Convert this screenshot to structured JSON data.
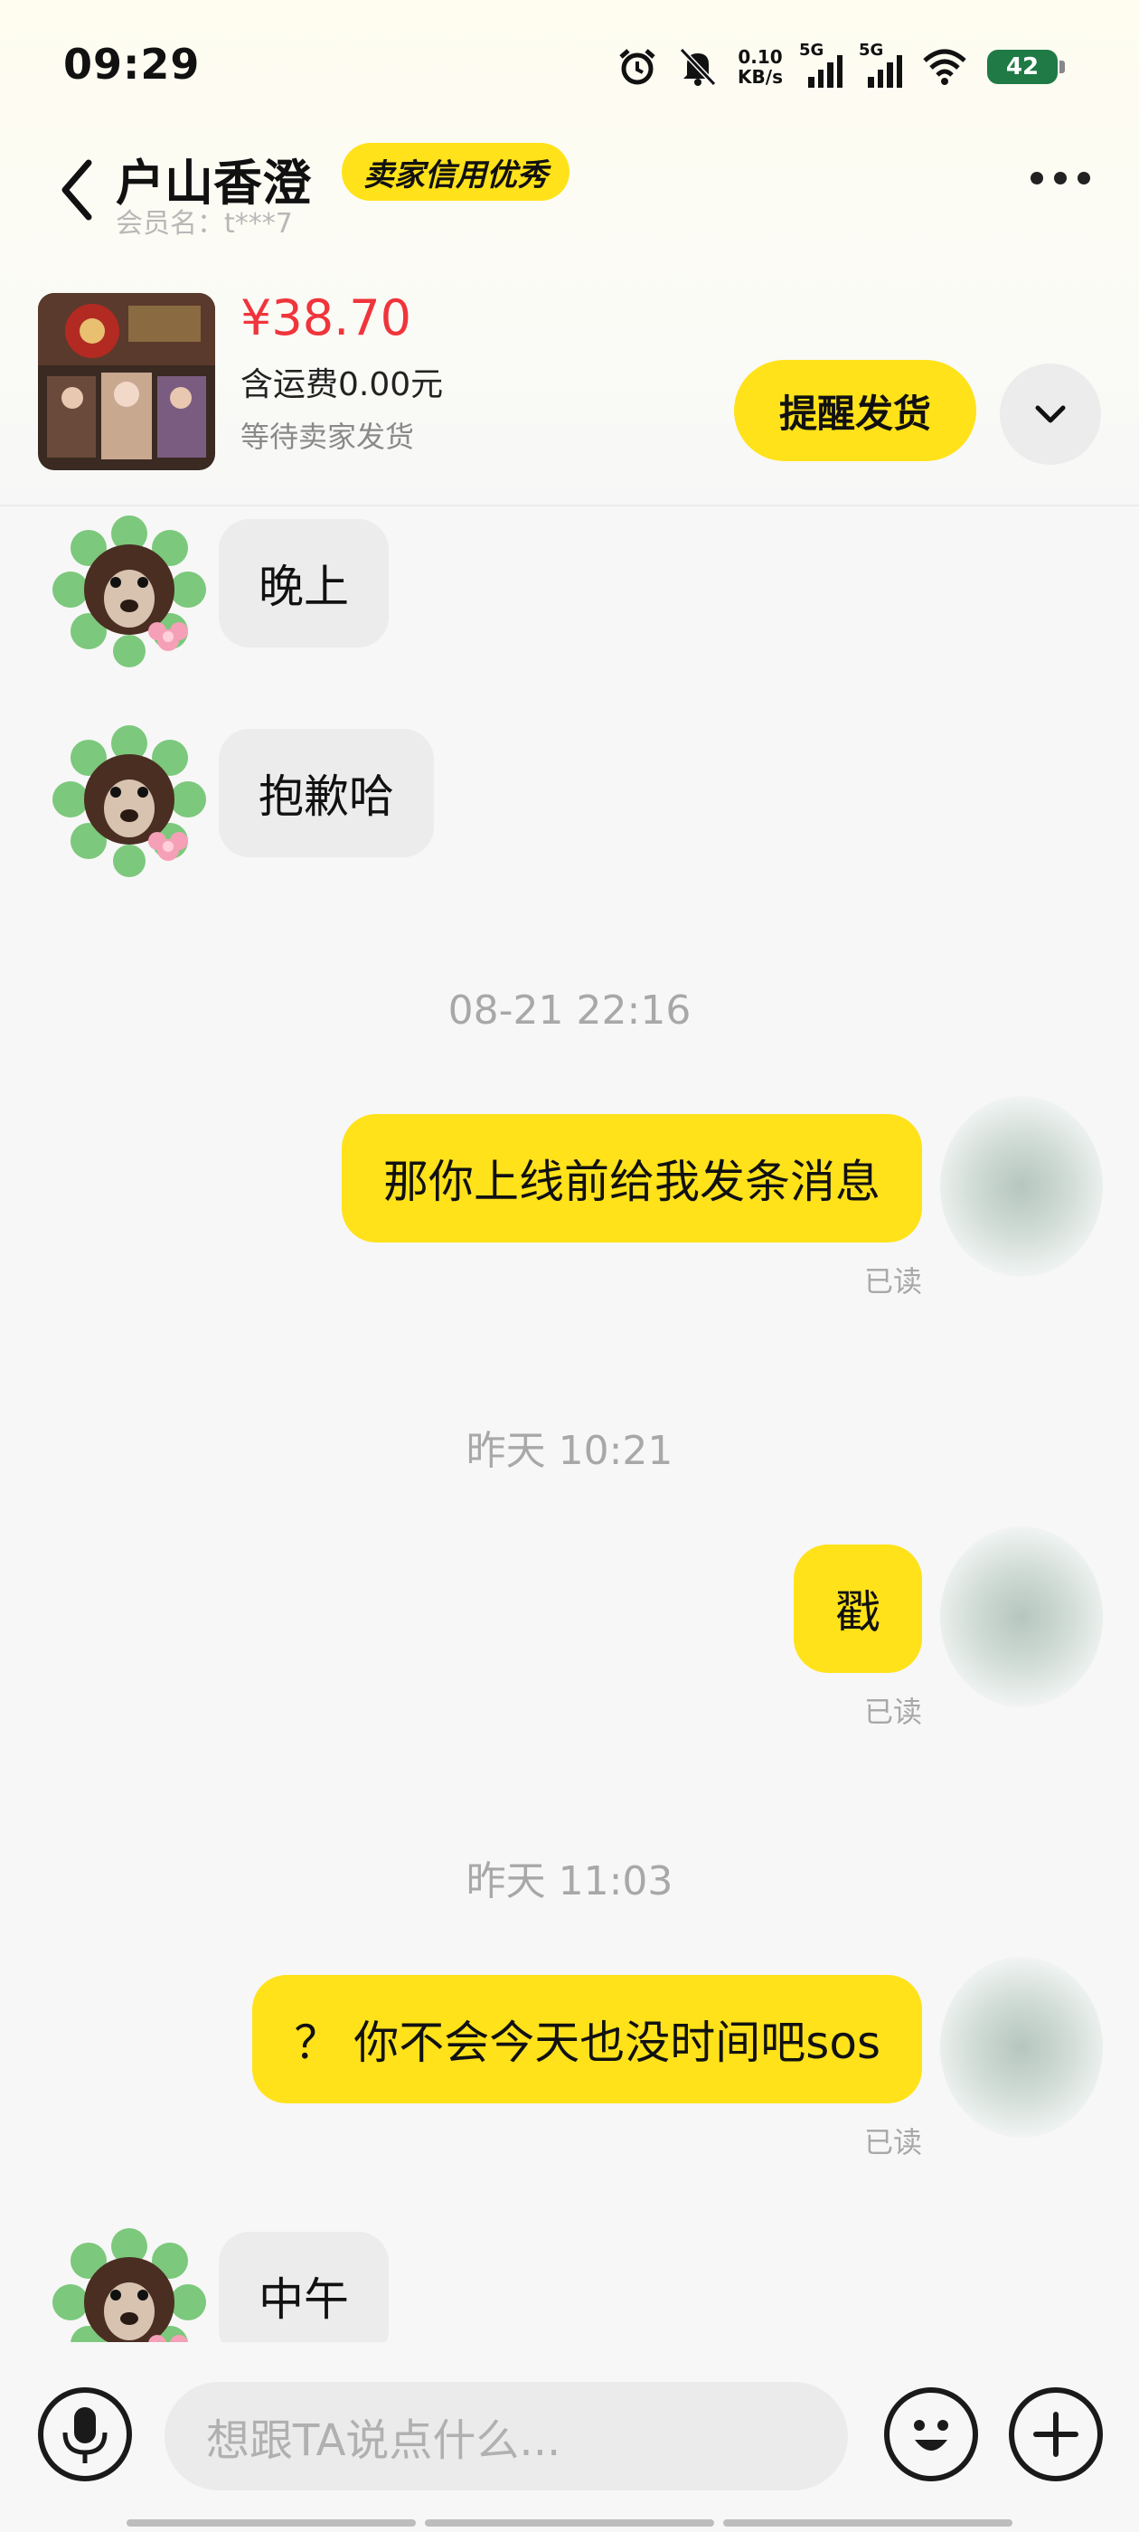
{
  "status_bar": {
    "time": "09:29",
    "net_speed_value": "0.10",
    "net_speed_unit": "KB/s",
    "sim1": "5G",
    "sim2": "5G",
    "battery": "42"
  },
  "header": {
    "seller_name": "户山香澄",
    "badge": "卖家信用优秀",
    "member_name": "会员名：t***7"
  },
  "product": {
    "price": "¥38.70",
    "shipping": "含运费0.00元",
    "status": "等待卖家发货",
    "remind_button": "提醒发货"
  },
  "messages": [
    {
      "side": "left",
      "text": "晚上"
    },
    {
      "side": "left",
      "text": "抱歉哈"
    },
    {
      "type": "time",
      "text": "08-21 22:16"
    },
    {
      "side": "right",
      "text": "那你上线前给我发条消息",
      "read": "已读"
    },
    {
      "type": "time",
      "text": "昨天 10:21"
    },
    {
      "side": "right",
      "text": "戳",
      "read": "已读"
    },
    {
      "type": "time",
      "text": "昨天 11:03"
    },
    {
      "side": "right",
      "text": "？ 你不会今天也没时间吧sos",
      "read": "已读"
    },
    {
      "side": "left",
      "text": "中午"
    }
  ],
  "input": {
    "placeholder": "想跟TA说点什么..."
  },
  "icons": {
    "back": "back-arrow-icon",
    "more": "more-dots-icon",
    "expand": "chevron-down-icon",
    "voice": "microphone-icon",
    "emoji": "emoji-icon",
    "plus": "plus-icon",
    "alarm": "alarm-icon",
    "mute": "bell-off-icon",
    "wifi": "wifi-icon"
  },
  "colors": {
    "accent_yellow": "#ffe21a",
    "price_red": "#f0343b"
  }
}
